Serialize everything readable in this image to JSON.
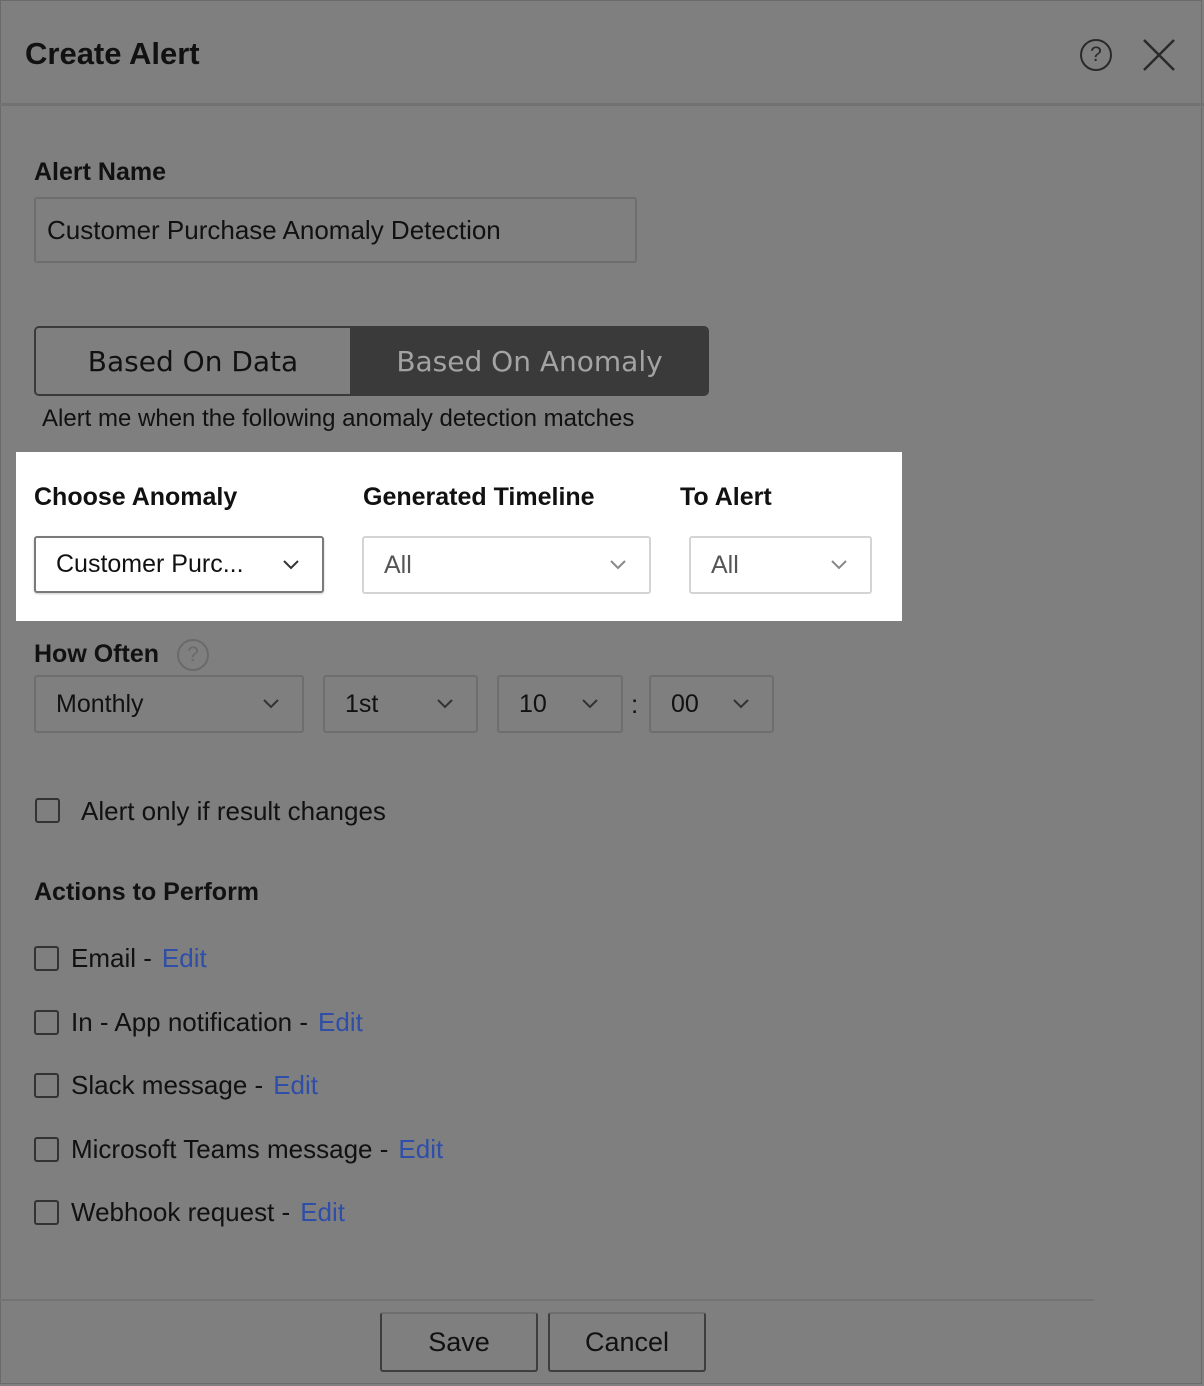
{
  "dialog": {
    "title": "Create Alert",
    "help_icon_glyph": "?",
    "close_icon": "close-icon"
  },
  "alert_name": {
    "label": "Alert Name",
    "value": "Customer Purchase Anomaly Detection"
  },
  "mode_toggle": {
    "options": [
      "Based On Data",
      "Based On Anomaly"
    ],
    "selected": "Based On Anomaly"
  },
  "description": "Alert me when the following anomaly detection matches",
  "anomaly": {
    "choose_label": "Choose Anomaly",
    "choose_value": "Customer Purc...",
    "timeline_label": "Generated Timeline",
    "timeline_value": "All",
    "to_alert_label": "To Alert",
    "to_alert_value": "All"
  },
  "schedule": {
    "label": "How Often",
    "help_glyph": "?",
    "frequency": "Monthly",
    "day": "1st",
    "hour": "10",
    "separator": ":",
    "minute": "00"
  },
  "only_if_changes": {
    "label": "Alert only if result changes",
    "checked": false
  },
  "actions": {
    "heading": "Actions to Perform",
    "items": [
      {
        "label": "Email - ",
        "link": "Edit",
        "checked": false
      },
      {
        "label": "In - App notification - ",
        "link": "Edit",
        "checked": false
      },
      {
        "label": "Slack message - ",
        "link": "Edit",
        "checked": false
      },
      {
        "label": "Microsoft Teams message - ",
        "link": "Edit",
        "checked": false
      },
      {
        "label": "Webhook request - ",
        "link": "Edit",
        "checked": false
      }
    ]
  },
  "footer": {
    "save_label": "Save",
    "cancel_label": "Cancel"
  },
  "colors": {
    "overlay": "#7f7f7f",
    "link": "#2e4ea8",
    "toggle_active": "#3a3a3a",
    "highlight": "#ffffff"
  }
}
